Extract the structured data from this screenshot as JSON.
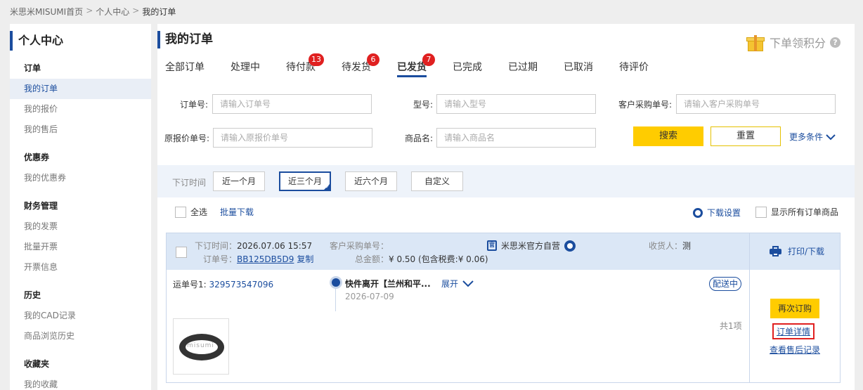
{
  "breadcrumb": [
    "米思米MISUMI首页",
    "个人中心",
    "我的订单"
  ],
  "breadcrumb_sep": ">",
  "sidebar": {
    "title": "个人中心",
    "sections": [
      {
        "title": "订单",
        "items": [
          {
            "label": "我的订单",
            "active": true
          },
          {
            "label": "我的报价"
          },
          {
            "label": "我的售后"
          }
        ]
      },
      {
        "title": "优惠券",
        "items": [
          {
            "label": "我的优惠券"
          }
        ]
      },
      {
        "title": "财务管理",
        "items": [
          {
            "label": "我的发票"
          },
          {
            "label": "批量开票"
          },
          {
            "label": "开票信息"
          }
        ]
      },
      {
        "title": "历史",
        "items": [
          {
            "label": "我的CAD记录"
          },
          {
            "label": "商品浏览历史"
          }
        ]
      },
      {
        "title": "收藏夹",
        "items": [
          {
            "label": "我的收藏"
          }
        ]
      }
    ]
  },
  "main": {
    "title": "我的订单",
    "points_label": "下单领积分",
    "help_icon": "?",
    "tabs": [
      {
        "label": "全部订单"
      },
      {
        "label": "处理中"
      },
      {
        "label": "待付款",
        "badge": "13"
      },
      {
        "label": "待发货",
        "badge": "6"
      },
      {
        "label": "已发货",
        "badge": "7",
        "active": true
      },
      {
        "label": "已完成"
      },
      {
        "label": "已过期"
      },
      {
        "label": "已取消"
      },
      {
        "label": "待评价"
      }
    ],
    "filters": {
      "order_no_label": "订单号:",
      "order_no_placeholder": "请输入订单号",
      "model_label": "型号:",
      "model_placeholder": "请输入型号",
      "po_label": "客户采购单号:",
      "po_placeholder": "请输入客户采购单号",
      "quote_label": "原报价单号:",
      "quote_placeholder": "请输入原报价单号",
      "product_label": "商品名:",
      "product_placeholder": "请输入商品名",
      "search_btn": "搜索",
      "reset_btn": "重置",
      "more_label": "更多条件"
    },
    "time": {
      "label": "下订时间",
      "options": [
        "近一个月",
        "近三个月",
        "近六个月",
        "自定义"
      ],
      "selected": "近三个月",
      "tick": "✓"
    },
    "select_all": "全选",
    "bulk_download": "批量下载",
    "download_settings": "下载设置",
    "show_all_items": "显示所有订单商品",
    "order": {
      "time_label": "下订时间：",
      "time_value": "2026.07.06 15:57",
      "no_label": "订单号：",
      "no_value": "BB125DB5D9",
      "copy": "复制",
      "po_label": "客户采购单号：",
      "total_label": "总金额：",
      "total_value": "¥ 0.50 (包含税费:¥ 0.06)",
      "shop_icon_text": "官",
      "shop": "米思米官方自营",
      "receiver_label": "收货人：",
      "receiver_value": "测",
      "print": "打印/下载",
      "waybill_label": "运单号1:",
      "waybill_no": "329573547096",
      "track_text": "快件离开【兰州和平...",
      "expand": "展开",
      "track_date": "2026-07-09",
      "status": "配送中",
      "count": "共1项",
      "thumb_text": "misumi",
      "reorder": "再次订购",
      "detail": "订单详情",
      "aftersale": "查看售后记录"
    }
  },
  "colors": {
    "brand_blue": "#1b4d9e",
    "yellow": "#ffcc00",
    "badge_red": "#e02020",
    "highlight_red": "#e02020"
  }
}
